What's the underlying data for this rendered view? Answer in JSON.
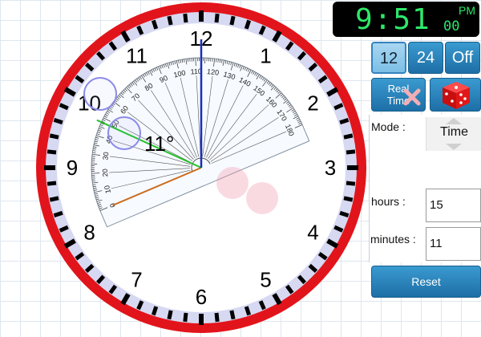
{
  "digital_clock": {
    "time": "9:51",
    "seconds": "00",
    "ampm": "PM"
  },
  "format_buttons": [
    {
      "label": "12",
      "active": true
    },
    {
      "label": "24",
      "active": false
    },
    {
      "label": "Off",
      "active": false
    }
  ],
  "realtime_button": {
    "line1": "Real",
    "line2": "Time"
  },
  "dice_icon": "dice-icon",
  "mode": {
    "label": "Mode :",
    "value": "Time"
  },
  "hours": {
    "label": "hours :",
    "value": "15"
  },
  "minutes": {
    "label": "minutes :",
    "value": "11"
  },
  "reset_label": "Reset",
  "clock": {
    "numbers": [
      "12",
      "1",
      "2",
      "3",
      "4",
      "5",
      "6",
      "7",
      "8",
      "9",
      "10",
      "11"
    ],
    "time_hour": 9,
    "time_minute": 51
  },
  "protractor": {
    "angle_reading": "11°",
    "scale_labels": [
      "0",
      "10",
      "20",
      "30",
      "40",
      "50",
      "60",
      "70",
      "80",
      "90",
      "100",
      "110",
      "120",
      "130",
      "140",
      "150",
      "160",
      "170",
      "180"
    ]
  },
  "colors": {
    "rim": "#e2141b",
    "hour_hand": "#cc6a1a",
    "minute_hand": "#1a2fb8",
    "line_green": "#22c22a",
    "button": "#1d6fa6"
  }
}
